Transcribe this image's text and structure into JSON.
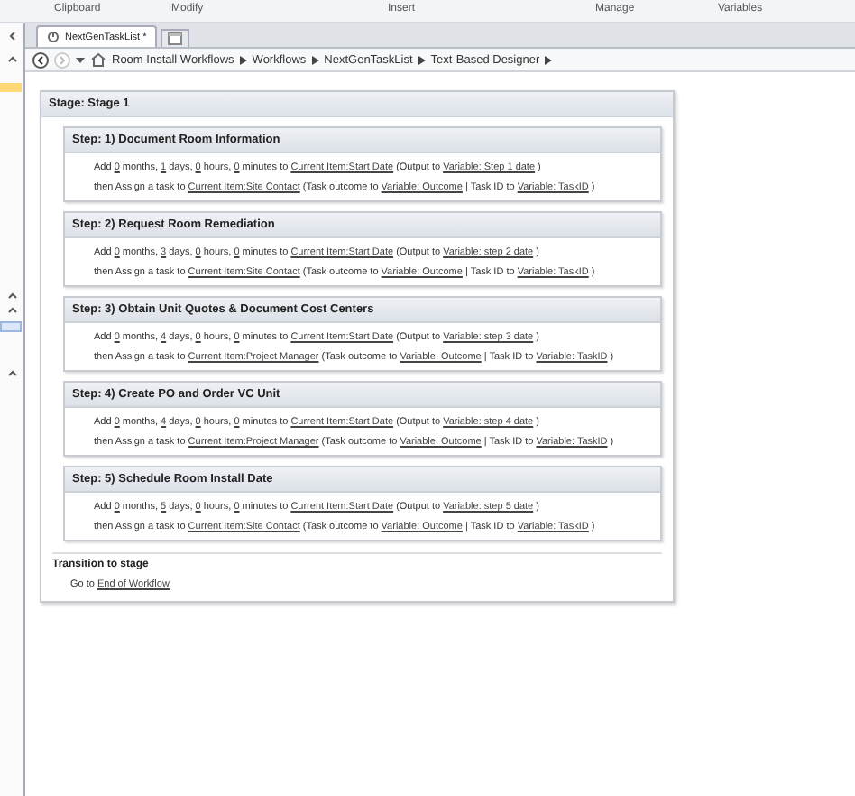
{
  "ribbon_groups": [
    "Clipboard",
    "Modify",
    "Insert",
    "Manage",
    "Variables"
  ],
  "tabs": [
    {
      "label": "NextGenTaskList *",
      "selected": true
    }
  ],
  "breadcrumb": [
    "Room Install Workflows",
    "Workflows",
    "NextGenTaskList",
    "Text-Based Designer"
  ],
  "stage": {
    "title": "Stage: Stage 1",
    "steps": [
      {
        "title": "Step: 1) Document Room Information",
        "lines": [
          [
            {
              "kind": "text",
              "text": "Add "
            },
            {
              "kind": "link",
              "text": "0"
            },
            {
              "kind": "text",
              "text": " months, "
            },
            {
              "kind": "link",
              "text": "1"
            },
            {
              "kind": "text",
              "text": " days, "
            },
            {
              "kind": "link",
              "text": "0"
            },
            {
              "kind": "text",
              "text": " hours, "
            },
            {
              "kind": "link",
              "text": "0"
            },
            {
              "kind": "text",
              "text": " minutes to "
            },
            {
              "kind": "link",
              "text": "Current Item:Start Date"
            },
            {
              "kind": "text",
              "text": " (Output to "
            },
            {
              "kind": "link",
              "text": "Variable: Step 1 date"
            },
            {
              "kind": "text",
              "text": " )"
            }
          ],
          [
            {
              "kind": "text",
              "text": "then Assign a task to "
            },
            {
              "kind": "link",
              "text": "Current Item:Site Contact"
            },
            {
              "kind": "text",
              "text": " (Task outcome to "
            },
            {
              "kind": "link",
              "text": "Variable: Outcome"
            },
            {
              "kind": "text",
              "text": " | Task ID to "
            },
            {
              "kind": "link",
              "text": "Variable: TaskID"
            },
            {
              "kind": "text",
              "text": " )"
            }
          ]
        ]
      },
      {
        "title": "Step: 2) Request Room Remediation",
        "lines": [
          [
            {
              "kind": "text",
              "text": "Add "
            },
            {
              "kind": "link",
              "text": "0"
            },
            {
              "kind": "text",
              "text": " months, "
            },
            {
              "kind": "link",
              "text": "3"
            },
            {
              "kind": "text",
              "text": " days, "
            },
            {
              "kind": "link",
              "text": "0"
            },
            {
              "kind": "text",
              "text": " hours, "
            },
            {
              "kind": "link",
              "text": "0"
            },
            {
              "kind": "text",
              "text": " minutes to "
            },
            {
              "kind": "link",
              "text": "Current Item:Start Date"
            },
            {
              "kind": "text",
              "text": " (Output to "
            },
            {
              "kind": "link",
              "text": "Variable: step 2 date"
            },
            {
              "kind": "text",
              "text": " )"
            }
          ],
          [
            {
              "kind": "text",
              "text": "then Assign a task to "
            },
            {
              "kind": "link",
              "text": "Current Item:Site Contact"
            },
            {
              "kind": "text",
              "text": " (Task outcome to "
            },
            {
              "kind": "link",
              "text": "Variable: Outcome"
            },
            {
              "kind": "text",
              "text": " | Task ID to "
            },
            {
              "kind": "link",
              "text": "Variable: TaskID"
            },
            {
              "kind": "text",
              "text": " )"
            }
          ]
        ]
      },
      {
        "title": "Step: 3) Obtain Unit Quotes & Document Cost Centers",
        "lines": [
          [
            {
              "kind": "text",
              "text": "Add "
            },
            {
              "kind": "link",
              "text": "0"
            },
            {
              "kind": "text",
              "text": " months, "
            },
            {
              "kind": "link",
              "text": "4"
            },
            {
              "kind": "text",
              "text": " days, "
            },
            {
              "kind": "link",
              "text": "0"
            },
            {
              "kind": "text",
              "text": " hours, "
            },
            {
              "kind": "link",
              "text": "0"
            },
            {
              "kind": "text",
              "text": " minutes to "
            },
            {
              "kind": "link",
              "text": "Current Item:Start Date"
            },
            {
              "kind": "text",
              "text": " (Output to "
            },
            {
              "kind": "link",
              "text": "Variable: step 3 date"
            },
            {
              "kind": "text",
              "text": " )"
            }
          ],
          [
            {
              "kind": "text",
              "text": "then Assign a task to "
            },
            {
              "kind": "link",
              "text": "Current Item:Project Manager"
            },
            {
              "kind": "text",
              "text": " (Task outcome to "
            },
            {
              "kind": "link",
              "text": "Variable: Outcome"
            },
            {
              "kind": "text",
              "text": " | Task ID to "
            },
            {
              "kind": "link",
              "text": "Variable: TaskID"
            },
            {
              "kind": "text",
              "text": " )"
            }
          ]
        ]
      },
      {
        "title": "Step: 4) Create PO and Order VC Unit",
        "lines": [
          [
            {
              "kind": "text",
              "text": "Add "
            },
            {
              "kind": "link",
              "text": "0"
            },
            {
              "kind": "text",
              "text": " months, "
            },
            {
              "kind": "link",
              "text": "4"
            },
            {
              "kind": "text",
              "text": " days, "
            },
            {
              "kind": "link",
              "text": "0"
            },
            {
              "kind": "text",
              "text": " hours, "
            },
            {
              "kind": "link",
              "text": "0"
            },
            {
              "kind": "text",
              "text": " minutes to "
            },
            {
              "kind": "link",
              "text": "Current Item:Start Date"
            },
            {
              "kind": "text",
              "text": " (Output to "
            },
            {
              "kind": "link",
              "text": "Variable: step 4 date"
            },
            {
              "kind": "text",
              "text": " )"
            }
          ],
          [
            {
              "kind": "text",
              "text": "then Assign a task to "
            },
            {
              "kind": "link",
              "text": "Current Item:Project Manager"
            },
            {
              "kind": "text",
              "text": " (Task outcome to "
            },
            {
              "kind": "link",
              "text": "Variable: Outcome"
            },
            {
              "kind": "text",
              "text": " | Task ID to "
            },
            {
              "kind": "link",
              "text": "Variable: TaskID"
            },
            {
              "kind": "text",
              "text": " )"
            }
          ]
        ]
      },
      {
        "title": "Step: 5) Schedule Room Install Date",
        "lines": [
          [
            {
              "kind": "text",
              "text": "Add "
            },
            {
              "kind": "link",
              "text": "0"
            },
            {
              "kind": "text",
              "text": " months, "
            },
            {
              "kind": "link",
              "text": "5"
            },
            {
              "kind": "text",
              "text": " days, "
            },
            {
              "kind": "link",
              "text": "0"
            },
            {
              "kind": "text",
              "text": " hours, "
            },
            {
              "kind": "link",
              "text": "0"
            },
            {
              "kind": "text",
              "text": " minutes to "
            },
            {
              "kind": "link",
              "text": "Current Item:Start Date"
            },
            {
              "kind": "text",
              "text": " (Output to "
            },
            {
              "kind": "link",
              "text": "Variable: step 5 date"
            },
            {
              "kind": "text",
              "text": " )"
            }
          ],
          [
            {
              "kind": "text",
              "text": "then Assign a task to "
            },
            {
              "kind": "link",
              "text": "Current Item:Site Contact"
            },
            {
              "kind": "text",
              "text": " (Task outcome to "
            },
            {
              "kind": "link",
              "text": "Variable: Outcome"
            },
            {
              "kind": "text",
              "text": " | Task ID to "
            },
            {
              "kind": "link",
              "text": "Variable: TaskID"
            },
            {
              "kind": "text",
              "text": " )"
            }
          ]
        ]
      }
    ],
    "transition": {
      "title": "Transition to stage",
      "line": [
        {
          "kind": "text",
          "text": "Go to "
        },
        {
          "kind": "link",
          "text": "End of Workflow"
        }
      ]
    }
  }
}
